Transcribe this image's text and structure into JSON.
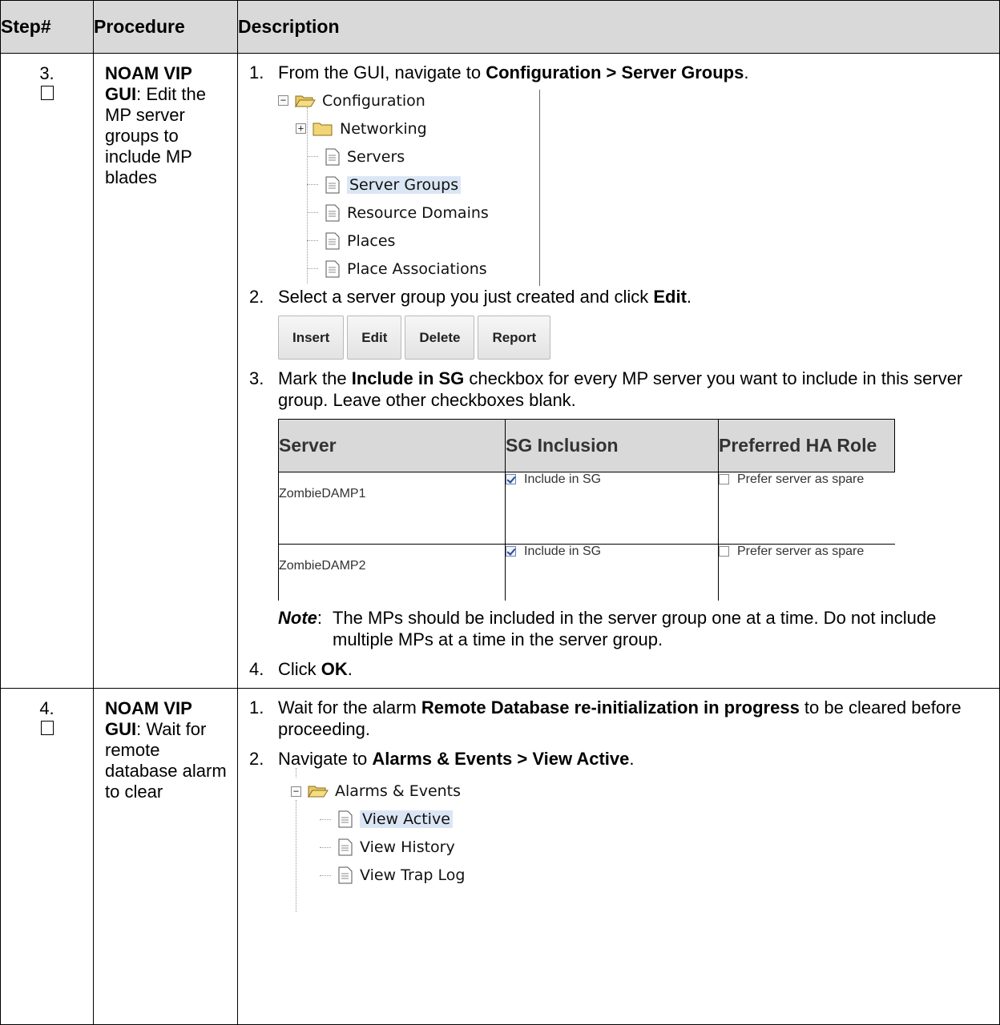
{
  "headers": {
    "step": "Step#",
    "procedure": "Procedure",
    "description": "Description"
  },
  "rows": [
    {
      "step": "3.",
      "proc_bold": "NOAM VIP GUI",
      "proc_rest": ": Edit the MP server groups to include MP blades",
      "item1": {
        "num": "1.",
        "pre": "From the GUI, navigate to ",
        "bold": "Configuration > Server Groups",
        "post": "."
      },
      "tree1": {
        "root": "Configuration",
        "items": [
          "Networking",
          "Servers",
          "Server Groups",
          "Resource Domains",
          "Places",
          "Place Associations"
        ]
      },
      "item2": {
        "num": "2.",
        "pre": "Select a server group you just created and click ",
        "bold": "Edit",
        "post": "."
      },
      "buttons": [
        "Insert",
        "Edit",
        "Delete",
        "Report"
      ],
      "item3": {
        "num": "3.",
        "pre": "Mark the ",
        "bold": "Include in SG",
        "post": " checkbox for every MP server you want to include in this server group.  Leave other checkboxes blank."
      },
      "sg_table": {
        "headers": [
          "Server",
          "SG Inclusion",
          "Preferred HA Role"
        ],
        "rows": [
          {
            "server": "ZombieDAMP1",
            "inclusion": "Include in SG",
            "role": "Prefer server as spare"
          },
          {
            "server": "ZombieDAMP2",
            "inclusion": "Include in SG",
            "role": "Prefer server as spare"
          }
        ]
      },
      "note": {
        "label": "Note",
        "colon": ":",
        "text": "The MPs should be included in the server group one at a time.  Do not include multiple MPs at a time in the server group."
      },
      "item4": {
        "num": "4.",
        "pre": "Click ",
        "bold": "OK",
        "post": "."
      }
    },
    {
      "step": "4.",
      "proc_bold": "NOAM VIP GUI",
      "proc_rest": ": Wait for remote database alarm to clear",
      "item1": {
        "num": "1.",
        "pre": "Wait for the alarm ",
        "bold": "Remote Database re-initialization in progress",
        "post": " to be cleared before proceeding."
      },
      "item2": {
        "num": "2.",
        "pre": "Navigate to ",
        "bold": "Alarms & Events > View Active",
        "post": "."
      },
      "tree2": {
        "root": "Alarms & Events",
        "items": [
          "View Active",
          "View History",
          "View Trap Log"
        ]
      }
    }
  ]
}
